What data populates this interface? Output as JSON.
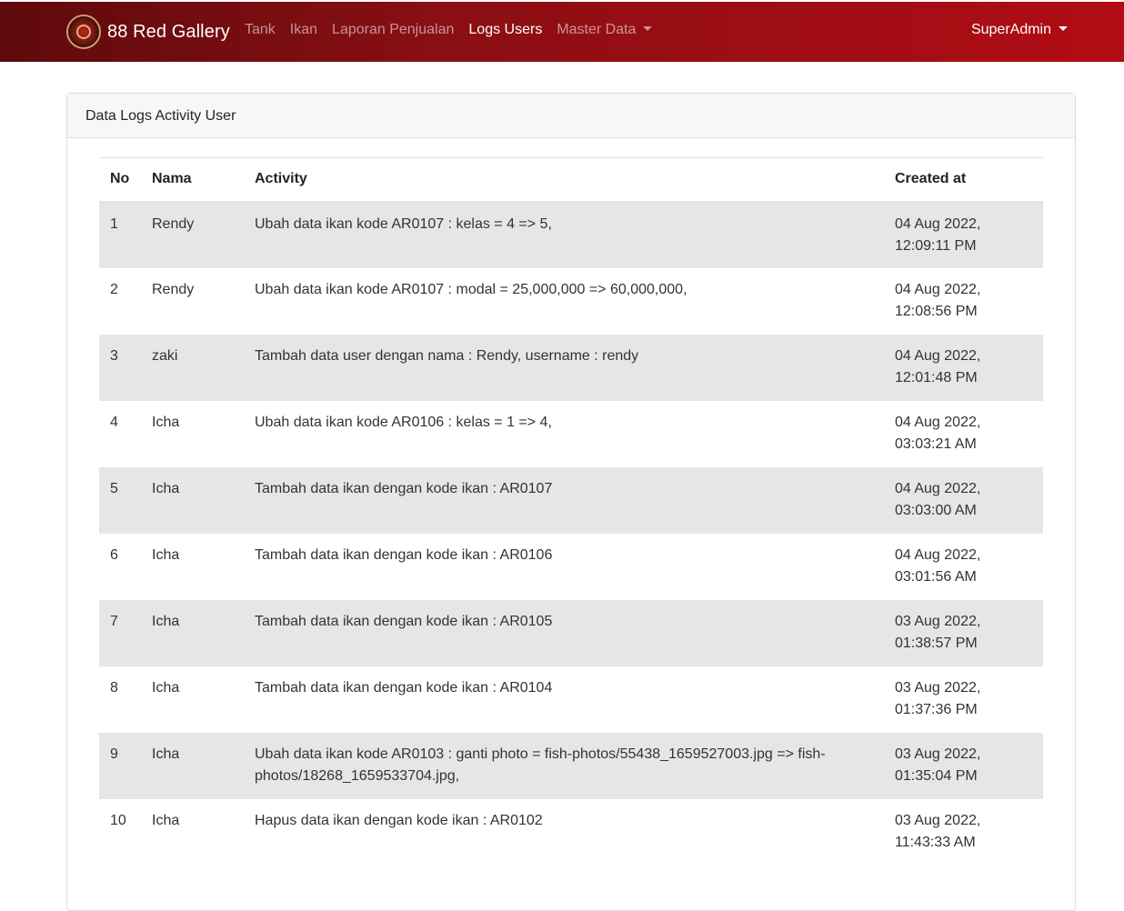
{
  "navbar": {
    "brand": "88 Red Gallery",
    "links": [
      {
        "label": "Tank"
      },
      {
        "label": "Ikan"
      },
      {
        "label": "Laporan Penjualan"
      },
      {
        "label": "Logs Users"
      },
      {
        "label": "Master Data"
      }
    ],
    "user": "SuperAdmin"
  },
  "card": {
    "title": "Data Logs Activity User"
  },
  "table": {
    "headers": [
      "No",
      "Nama",
      "Activity",
      "Created at"
    ],
    "rows": [
      {
        "no": "1",
        "nama": "Rendy",
        "activity": "Ubah data ikan kode AR0107 : kelas = 4 => 5,",
        "date": "04 Aug 2022,",
        "time": "12:09:11 PM"
      },
      {
        "no": "2",
        "nama": "Rendy",
        "activity": "Ubah data ikan kode AR0107 : modal = 25,000,000 => 60,000,000,",
        "date": "04 Aug 2022,",
        "time": "12:08:56 PM"
      },
      {
        "no": "3",
        "nama": "zaki",
        "activity": "Tambah data user dengan nama : Rendy, username : rendy",
        "date": "04 Aug 2022,",
        "time": "12:01:48 PM"
      },
      {
        "no": "4",
        "nama": "Icha",
        "activity": "Ubah data ikan kode AR0106 : kelas = 1 => 4,",
        "date": "04 Aug 2022,",
        "time": "03:03:21 AM"
      },
      {
        "no": "5",
        "nama": "Icha",
        "activity": "Tambah data ikan dengan kode ikan : AR0107",
        "date": "04 Aug 2022,",
        "time": "03:03:00 AM"
      },
      {
        "no": "6",
        "nama": "Icha",
        "activity": "Tambah data ikan dengan kode ikan : AR0106",
        "date": "04 Aug 2022,",
        "time": "03:01:56 AM"
      },
      {
        "no": "7",
        "nama": "Icha",
        "activity": "Tambah data ikan dengan kode ikan : AR0105",
        "date": "03 Aug 2022,",
        "time": "01:38:57 PM"
      },
      {
        "no": "8",
        "nama": "Icha",
        "activity": "Tambah data ikan dengan kode ikan : AR0104",
        "date": "03 Aug 2022,",
        "time": "01:37:36 PM"
      },
      {
        "no": "9",
        "nama": "Icha",
        "activity": "Ubah data ikan kode AR0103 : ganti photo = fish-photos/55438_1659527003.jpg => fish-photos/18268_1659533704.jpg,",
        "date": "03 Aug 2022,",
        "time": "01:35:04 PM"
      },
      {
        "no": "10",
        "nama": "Icha",
        "activity": "Hapus data ikan dengan kode ikan : AR0102",
        "date": "03 Aug 2022,",
        "time": "11:43:33 AM"
      }
    ]
  },
  "colors": {
    "navbar_start": "#5e0a0c",
    "navbar_end": "#b20c14",
    "row_stripe": "#e6e6e6"
  },
  "icons": {
    "logo": "brand-logo-icon",
    "dropdown": "caret-down-icon"
  }
}
